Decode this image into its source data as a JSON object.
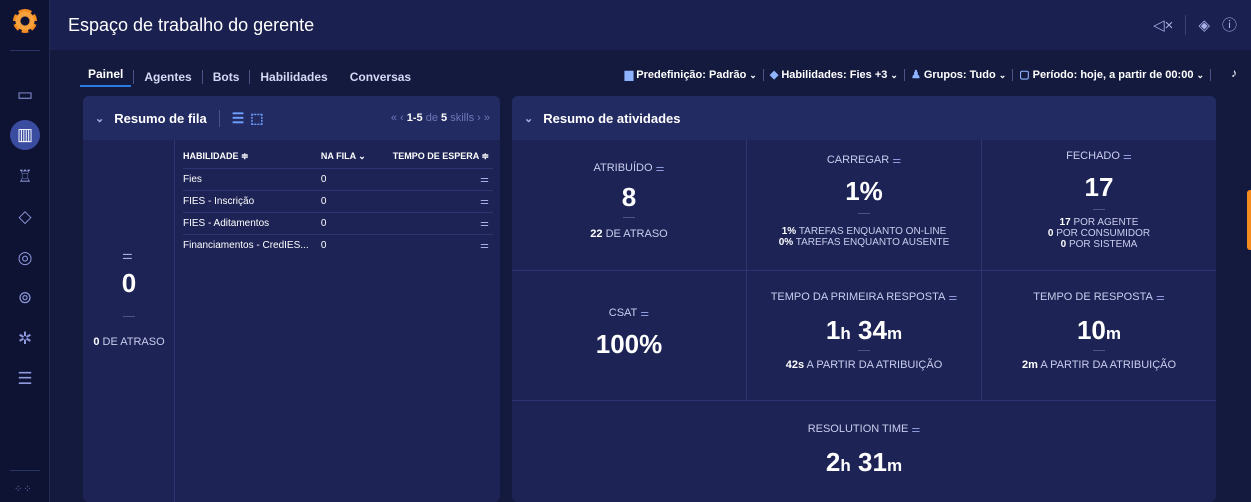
{
  "app": {
    "title": "Espaço de trabalho do gerente"
  },
  "tabs": [
    {
      "label": "Painel"
    },
    {
      "label": "Agentes"
    },
    {
      "label": "Bots"
    },
    {
      "label": "Habilidades"
    },
    {
      "label": "Conversas"
    }
  ],
  "filters": {
    "predefinicao": "Predefinição: Padrão",
    "habilidades": "Habilidades: Fies +3",
    "grupos": "Grupos: Tudo",
    "periodo": "Período: hoje, a partir de 00:00"
  },
  "fila": {
    "title": "Resumo de fila",
    "pager_range": "1-5",
    "pager_of": "de",
    "pager_total": "5",
    "pager_unit": "skills",
    "total": "0",
    "atraso_num": "0",
    "atraso_label": "DE ATRASO",
    "headers": {
      "skill": "HABILIDADE ≑",
      "queue": "NA FILA ⌄",
      "wait": "TEMPO DE ESPERA ≑"
    },
    "rows": [
      {
        "skill": "Fies",
        "queue": "0"
      },
      {
        "skill": "FIES - Inscrição",
        "queue": "0"
      },
      {
        "skill": "FIES - Aditamentos",
        "queue": "0"
      },
      {
        "skill": "Financiamentos - CredIES...",
        "queue": "0"
      }
    ]
  },
  "atividades": {
    "title": "Resumo de atividades",
    "atribuido": {
      "label": "ATRIBUÍDO",
      "value": "8",
      "sub_num": "22",
      "sub_label": "DE ATRASO"
    },
    "carregar": {
      "label": "CARREGAR",
      "value": "1%",
      "l1_num": "1%",
      "l1": "TAREFAS ENQUANTO ON-LINE",
      "l2_num": "0%",
      "l2": "TAREFAS ENQUANTO AUSENTE"
    },
    "fechado": {
      "label": "FECHADO",
      "value": "17",
      "l1_num": "17",
      "l1": "POR AGENTE",
      "l2_num": "0",
      "l2": "POR CONSUMIDOR",
      "l3_num": "0",
      "l3": "POR SISTEMA"
    },
    "csat": {
      "label": "CSAT",
      "value": "100%"
    },
    "primeira_resposta": {
      "label": "TEMPO DA PRIMEIRA RESPOSTA",
      "h": "1",
      "hu": "h",
      "m": "34",
      "mu": "m",
      "sub_num": "42s",
      "sub_label": "A PARTIR DA ATRIBUIÇÃO"
    },
    "tempo_resposta": {
      "label": "TEMPO DE RESPOSTA",
      "m": "10",
      "mu": "m",
      "sub_num": "2m",
      "sub_label": "A PARTIR DA ATRIBUIÇÃO"
    },
    "resolution": {
      "label": "RESOLUTION TIME",
      "h": "2",
      "hu": "h",
      "m": "31",
      "mu": "m"
    }
  }
}
